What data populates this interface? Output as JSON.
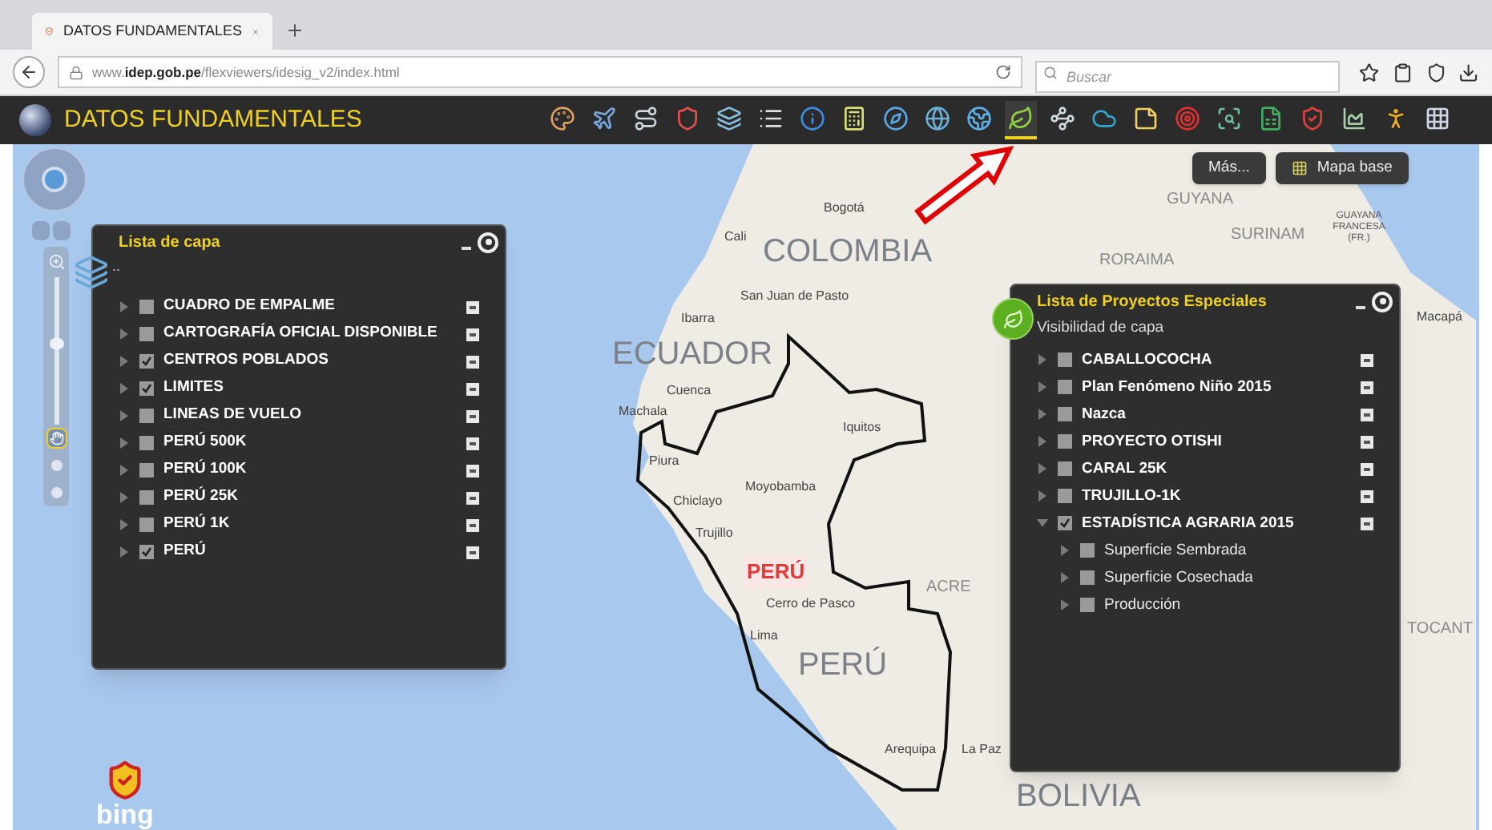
{
  "browser": {
    "tab_title": "DATOS FUNDAMENTALES",
    "url": "www.**idep.gob.pe**/flexviewers/idesig_v2/index.html",
    "search_placeholder": "Buscar"
  },
  "app": {
    "title": "DATOS FUNDAMENTALES",
    "tools": [
      {
        "kind": "palette",
        "selected": false
      },
      {
        "kind": "plane",
        "selected": false
      },
      {
        "kind": "route",
        "selected": false
      },
      {
        "kind": "shield",
        "selected": false
      },
      {
        "kind": "layers",
        "selected": false
      },
      {
        "kind": "list",
        "selected": false
      },
      {
        "kind": "info",
        "selected": false
      },
      {
        "kind": "calculator",
        "selected": false
      },
      {
        "kind": "compass",
        "selected": false
      },
      {
        "kind": "globe",
        "selected": false
      },
      {
        "kind": "earth",
        "selected": false
      },
      {
        "kind": "leaf",
        "selected": true
      },
      {
        "kind": "waypoints",
        "selected": false
      },
      {
        "kind": "cloud",
        "selected": false
      },
      {
        "kind": "note",
        "selected": false
      },
      {
        "kind": "target",
        "selected": false
      },
      {
        "kind": "search",
        "selected": false
      },
      {
        "kind": "sheet",
        "selected": false
      },
      {
        "kind": "badge",
        "selected": false
      },
      {
        "kind": "chart",
        "selected": false
      },
      {
        "kind": "person",
        "selected": false
      },
      {
        "kind": "grid",
        "selected": false
      }
    ]
  },
  "map": {
    "buttons": [
      "Más...",
      "Mapa base"
    ],
    "zoom_slider": {
      "level": 0.55
    },
    "nav_tools": [
      {
        "selected": true
      },
      {
        "selected": false
      },
      {
        "selected": false
      }
    ],
    "attribution": "bing",
    "labels": [
      {
        "text": "Bogotá",
        "kind": "city"
      },
      {
        "text": "Cali",
        "kind": "city"
      },
      {
        "text": "COLOMBIA",
        "kind": "country"
      },
      {
        "text": "San Juan de Pasto",
        "kind": "city"
      },
      {
        "text": "Ibarra",
        "kind": "city"
      },
      {
        "text": "ECUADOR",
        "kind": "country"
      },
      {
        "text": "Machala",
        "kind": "city"
      },
      {
        "text": "Cuenca",
        "kind": "city"
      },
      {
        "text": "Piura",
        "kind": "city"
      },
      {
        "text": "Iquitos",
        "kind": "city"
      },
      {
        "text": "Moyobamba",
        "kind": "city"
      },
      {
        "text": "Chiclayo",
        "kind": "city"
      },
      {
        "text": "Trujillo",
        "kind": "city"
      },
      {
        "text": "PERÚ",
        "kind": "highlight"
      },
      {
        "text": "Cerro de Pasco",
        "kind": "city"
      },
      {
        "text": "Lima",
        "kind": "city"
      },
      {
        "text": "PERÚ",
        "kind": "country"
      },
      {
        "text": "ACRE",
        "kind": "region"
      },
      {
        "text": "Arequipa",
        "kind": "city"
      },
      {
        "text": "La Paz",
        "kind": "city"
      },
      {
        "text": "BOLIVIA",
        "kind": "country"
      },
      {
        "text": "GUYANA",
        "kind": "region"
      },
      {
        "text": "SURINAM",
        "kind": "region"
      },
      {
        "text": "GUAYANA FRANCESA (FR.)",
        "kind": "small"
      },
      {
        "text": "RORAIMA",
        "kind": "region"
      },
      {
        "text": "Macapá",
        "kind": "city"
      },
      {
        "text": "TOCANT",
        "kind": "region"
      }
    ]
  },
  "layers_panel": {
    "title": "Lista de capa",
    "subtitle": "..",
    "items": [
      {
        "label": "CUADRO DE EMPALME",
        "checked": false,
        "expanded": false
      },
      {
        "label": "CARTOGRAFÍA OFICIAL DISPONIBLE",
        "checked": false,
        "expanded": false
      },
      {
        "label": "CENTROS POBLADOS",
        "checked": true,
        "expanded": false
      },
      {
        "label": "LIMITES",
        "checked": true,
        "expanded": false
      },
      {
        "label": "LINEAS DE VUELO",
        "checked": false,
        "expanded": false
      },
      {
        "label": "PERÚ 500K",
        "checked": false,
        "expanded": false
      },
      {
        "label": "PERÚ 100K",
        "checked": false,
        "expanded": false
      },
      {
        "label": "PERÚ 25K",
        "checked": false,
        "expanded": false
      },
      {
        "label": "PERÚ 1K",
        "checked": false,
        "expanded": false
      },
      {
        "label": "PERÚ",
        "checked": true,
        "expanded": false
      }
    ]
  },
  "projects_panel": {
    "title": "Lista de Proyectos Especiales",
    "subtitle": "Visibilidad de capa",
    "items": [
      {
        "label": "CABALLOCOCHA",
        "checked": false,
        "expanded": false
      },
      {
        "label": "Plan Fenómeno Niño 2015",
        "checked": false,
        "expanded": false
      },
      {
        "label": "Nazca",
        "checked": false,
        "expanded": false
      },
      {
        "label": "PROYECTO OTISHI",
        "checked": false,
        "expanded": false
      },
      {
        "label": "CARAL 25K",
        "checked": false,
        "expanded": false
      },
      {
        "label": "TRUJILLO-1K",
        "checked": false,
        "expanded": false
      },
      {
        "label": "ESTADÍSTICA AGRARIA 2015",
        "checked": true,
        "expanded": true,
        "children": [
          {
            "label": "Superficie Sembrada",
            "checked": false,
            "expanded": false
          },
          {
            "label": "Superficie Cosechada",
            "checked": false,
            "expanded": false
          },
          {
            "label": "Producción",
            "checked": false,
            "expanded": false
          }
        ]
      }
    ]
  }
}
